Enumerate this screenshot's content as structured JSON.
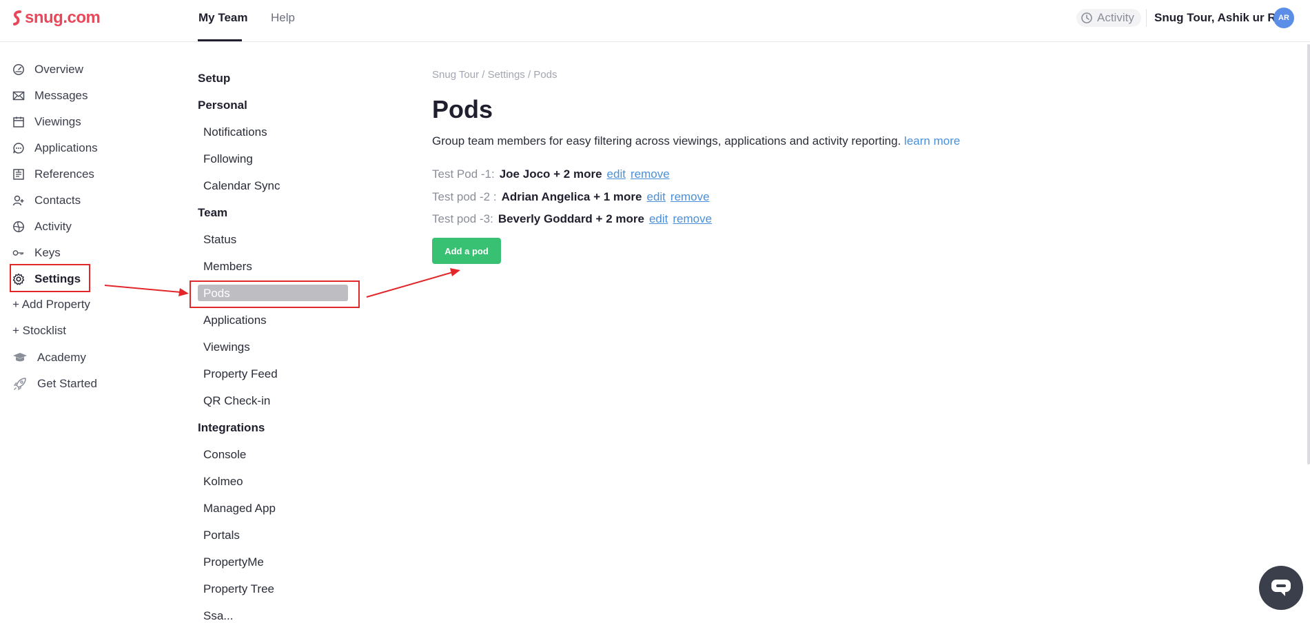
{
  "header": {
    "logo_text": "snug.com",
    "nav": [
      {
        "label": "My Team",
        "active": true
      },
      {
        "label": "Help",
        "active": false
      }
    ],
    "activity_label": "Activity",
    "account_label": "Snug Tour,  Ashik ur R.",
    "avatar_initials": "AR"
  },
  "leftnav": {
    "items": [
      {
        "label": "Overview",
        "icon": "dashboard-icon"
      },
      {
        "label": "Messages",
        "icon": "envelope-icon"
      },
      {
        "label": "Viewings",
        "icon": "calendar-icon"
      },
      {
        "label": "Applications",
        "icon": "chat-dots-icon"
      },
      {
        "label": "References",
        "icon": "document-list-icon"
      },
      {
        "label": "Contacts",
        "icon": "add-person-icon"
      },
      {
        "label": "Activity",
        "icon": "globe-icon"
      },
      {
        "label": "Keys",
        "icon": "key-icon"
      },
      {
        "label": "Settings",
        "icon": "gear-icon",
        "active": true
      }
    ],
    "add_property": "+ Add Property",
    "stocklist": "+ Stocklist",
    "academy": "Academy",
    "get_started": "Get Started"
  },
  "settings_nav": {
    "setup": "Setup",
    "personal": "Personal",
    "personal_items": [
      "Notifications",
      "Following",
      "Calendar Sync"
    ],
    "team": "Team",
    "team_items": [
      "Status",
      "Members",
      "Pods",
      "Applications",
      "Viewings",
      "Property Feed",
      "QR Check-in"
    ],
    "selected": "Pods",
    "integrations": "Integrations",
    "integration_items": [
      "Console",
      "Kolmeo",
      "Managed App",
      "Portals",
      "PropertyMe",
      "Property Tree",
      "Ssa..."
    ]
  },
  "main": {
    "breadcrumb": "Snug Tour / Settings / Pods",
    "title": "Pods",
    "description": "Group team members for easy filtering across viewings, applications and activity reporting.",
    "learn_more": "learn more",
    "pods": [
      {
        "name": "Test Pod -1:",
        "members": "Joe Joco + 2 more",
        "edit": "edit",
        "remove": "remove"
      },
      {
        "name": "Test pod -2 :",
        "members": "Adrian Angelica + 1 more",
        "edit": "edit",
        "remove": "remove"
      },
      {
        "name": "Test pod -3:",
        "members": "Beverly Goddard + 2 more",
        "edit": "edit",
        "remove": "remove"
      }
    ],
    "add_button": "Add a pod"
  },
  "colors": {
    "brand": "#e8485a",
    "primary_button": "#38c172",
    "link": "#4a90d9",
    "annotation": "#e2272b",
    "selected_nav": "#bdbdc2"
  }
}
